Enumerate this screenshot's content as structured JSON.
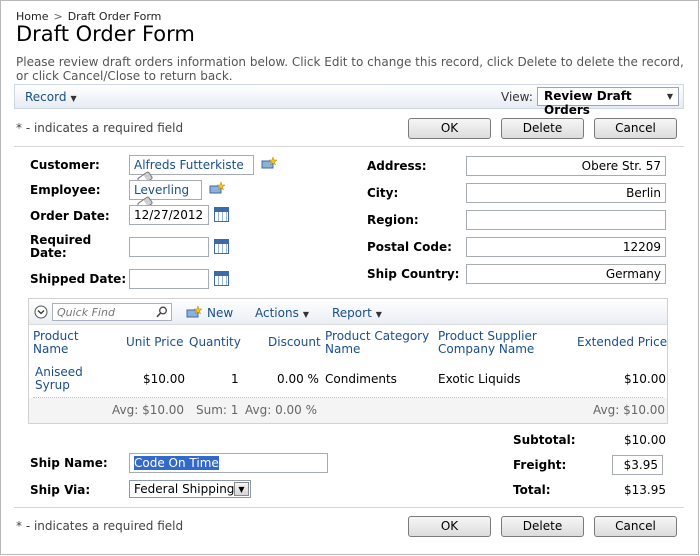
{
  "breadcrumb": {
    "home": "Home",
    "separator": ">",
    "current": "Draft Order Form"
  },
  "page": {
    "title": "Draft Order Form",
    "description": "Please review draft orders information below. Click Edit to change this record, click Delete to delete the record, or click Cancel/Close to return back."
  },
  "toolbar": {
    "record_menu": "Record",
    "view_label": "View:",
    "view_value": "Review Draft Orders"
  },
  "required_note": "* - indicates a required field",
  "actions": {
    "ok": "OK",
    "delete": "Delete",
    "cancel": "Cancel"
  },
  "form": {
    "customer": {
      "label": "Customer:",
      "value": "Alfreds Futterkiste"
    },
    "employee": {
      "label": "Employee:",
      "value": "Leverling"
    },
    "order_date": {
      "label": "Order Date:",
      "value": "12/27/2012"
    },
    "required_date": {
      "label": "Required Date:",
      "value": ""
    },
    "shipped_date": {
      "label": "Shipped Date:",
      "value": ""
    },
    "address": {
      "label": "Address:",
      "value": "Obere Str. 57"
    },
    "city": {
      "label": "City:",
      "value": "Berlin"
    },
    "region": {
      "label": "Region:",
      "value": ""
    },
    "postal_code": {
      "label": "Postal Code:",
      "value": "12209"
    },
    "ship_country": {
      "label": "Ship Country:",
      "value": "Germany"
    },
    "ship_name": {
      "label": "Ship Name:",
      "value": "Code On Time"
    },
    "ship_via": {
      "label": "Ship Via:",
      "value": "Federal Shipping"
    }
  },
  "details": {
    "quick_find_placeholder": "Quick Find",
    "new_label": "New",
    "actions_label": "Actions",
    "report_label": "Report",
    "columns": [
      "Product Name",
      "Unit Price",
      "Quantity",
      "Discount",
      "Product Category Name",
      "Product Supplier Company Name",
      "Extended Price"
    ],
    "rows": [
      {
        "product": "Aniseed Syrup",
        "unit_price": "$10.00",
        "quantity": "1",
        "discount": "0.00 %",
        "category": "Condiments",
        "supplier": "Exotic Liquids",
        "extended_price": "$10.00"
      }
    ],
    "aggregates": {
      "unit_price": "Avg: $10.00",
      "quantity": "Sum: 1",
      "discount": "Avg: 0.00 %",
      "extended_price": "Avg: $10.00"
    }
  },
  "totals": {
    "subtotal": {
      "label": "Subtotal:",
      "value": "$10.00"
    },
    "freight": {
      "label": "Freight:",
      "value": "$3.95"
    },
    "total": {
      "label": "Total:",
      "value": "$13.95"
    }
  },
  "icons": [
    "new-record-icon",
    "eraser-icon",
    "calendar-icon",
    "collapse-icon",
    "search-icon",
    "dropdown-arrow-icon"
  ]
}
